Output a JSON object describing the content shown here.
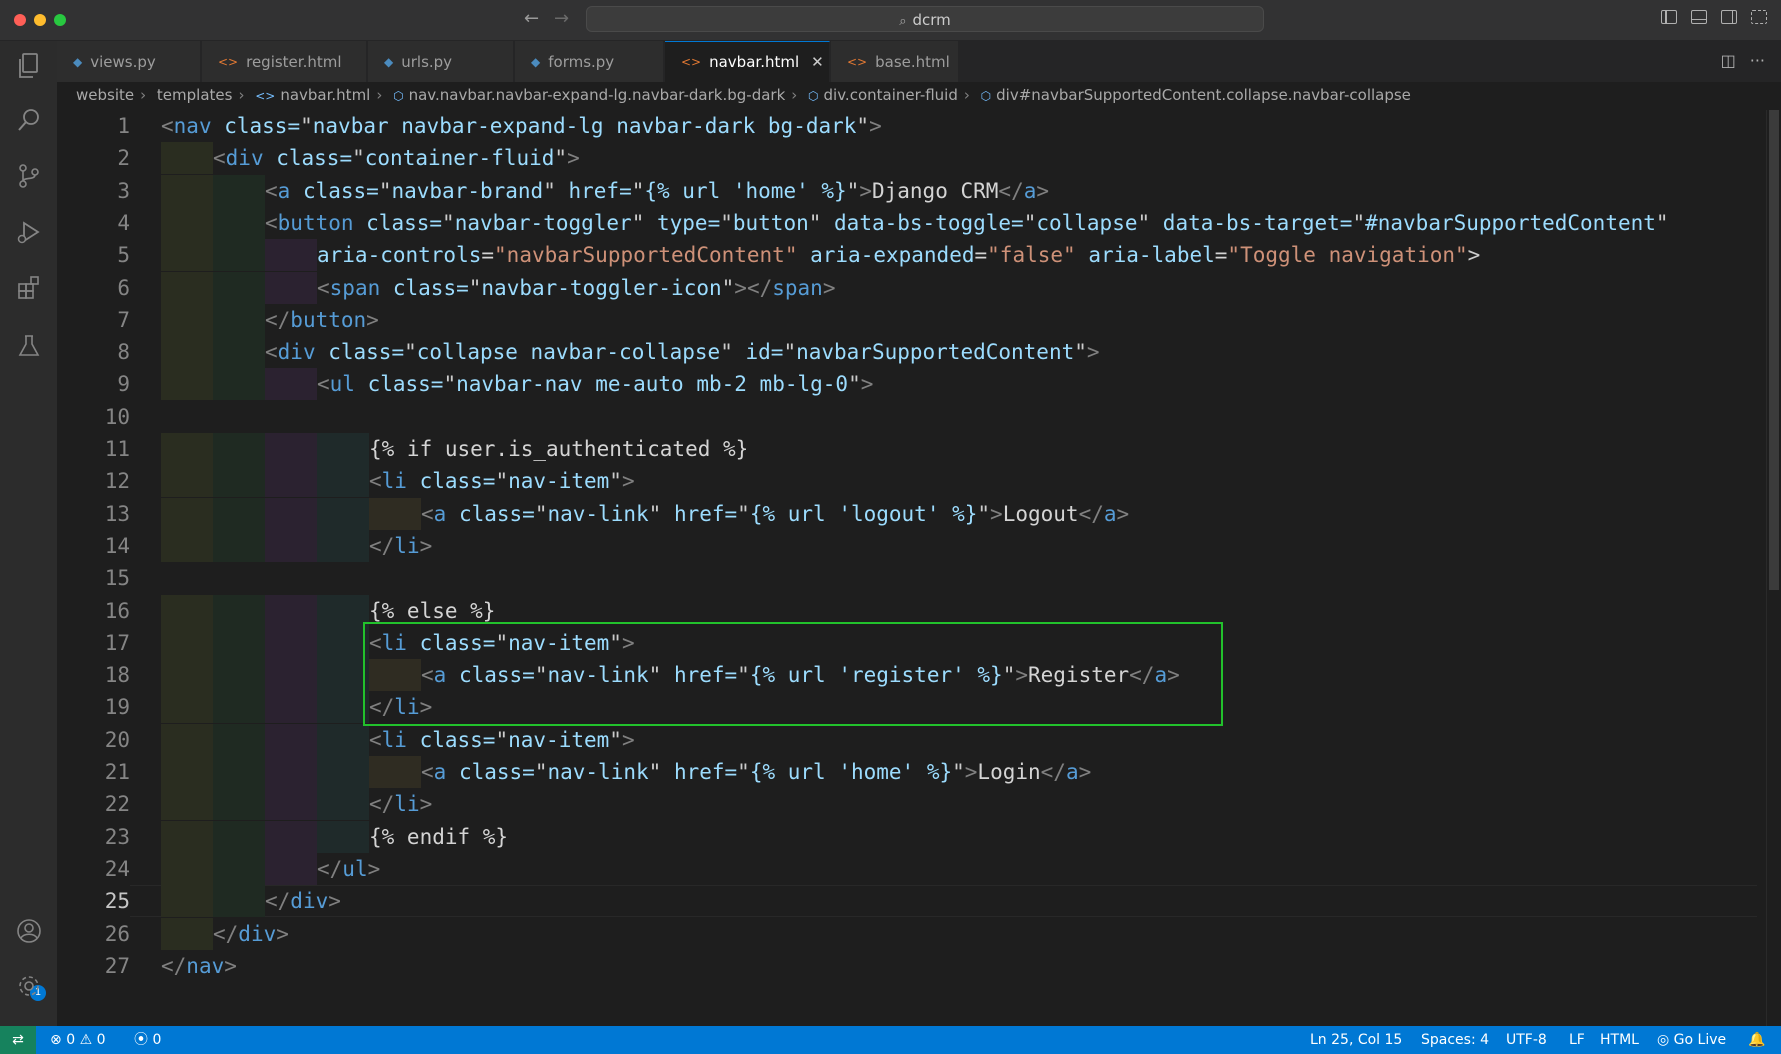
{
  "window": {
    "search_text": "dcrm"
  },
  "tabs": [
    {
      "label": "views.py",
      "kind": "py"
    },
    {
      "label": "register.html",
      "kind": "html"
    },
    {
      "label": "urls.py",
      "kind": "py"
    },
    {
      "label": "forms.py",
      "kind": "py"
    },
    {
      "label": "navbar.html",
      "kind": "html",
      "active": true
    },
    {
      "label": "base.html",
      "kind": "html"
    }
  ],
  "breadcrumb": [
    "website",
    "templates",
    "navbar.html",
    "nav.navbar.navbar-expand-lg.navbar-dark.bg-dark",
    "div.container-fluid",
    "div#navbarSupportedContent.collapse.navbar-collapse"
  ],
  "line_numbers": [
    "1",
    "2",
    "3",
    "4",
    "5",
    "6",
    "7",
    "8",
    "9",
    "10",
    "11",
    "12",
    "13",
    "14",
    "15",
    "16",
    "17",
    "18",
    "19",
    "20",
    "21",
    "22",
    "23",
    "24",
    "25",
    "26",
    "27"
  ],
  "code_lines": [
    "<nav class=\"navbar navbar-expand-lg navbar-dark bg-dark\">",
    "<div class=\"container-fluid\">",
    "<a class=\"navbar-brand\" href=\"{% url 'home' %}\">Django CRM</a>",
    "<button class=\"navbar-toggler\" type=\"button\" data-bs-toggle=\"collapse\" data-bs-target=\"#navbarSupportedContent\"",
    "aria-controls=\"navbarSupportedContent\" aria-expanded=\"false\" aria-label=\"Toggle navigation\">",
    "<span class=\"navbar-toggler-icon\"></span>",
    "</button>",
    "<div class=\"collapse navbar-collapse\" id=\"navbarSupportedContent\">",
    "<ul class=\"navbar-nav me-auto mb-2 mb-lg-0\">",
    "",
    "{% if user.is_authenticated %}",
    "<li class=\"nav-item\">",
    "<a class=\"nav-link\" href=\"{% url 'logout' %}\">Logout</a>",
    "</li>",
    "",
    "{% else %}",
    "<li class=\"nav-item\">",
    "<a class=\"nav-link\" href=\"{% url 'register' %}\">Register</a>",
    "</li>",
    "<li class=\"nav-item\">",
    "<a class=\"nav-link\" href=\"{% url 'home' %}\">Login</a>",
    "</li>",
    "{% endif %}",
    "</ul>",
    "</div>",
    "</div>",
    "</nav>"
  ],
  "cursor_line": "25",
  "status": {
    "errors": "0",
    "warnings": "0",
    "ports": "0",
    "position": "Ln 25, Col 15",
    "spaces": "Spaces: 4",
    "encoding": "UTF-8",
    "eol": "LF",
    "language": "HTML",
    "go_live": "Go Live"
  },
  "account_badge": "1"
}
